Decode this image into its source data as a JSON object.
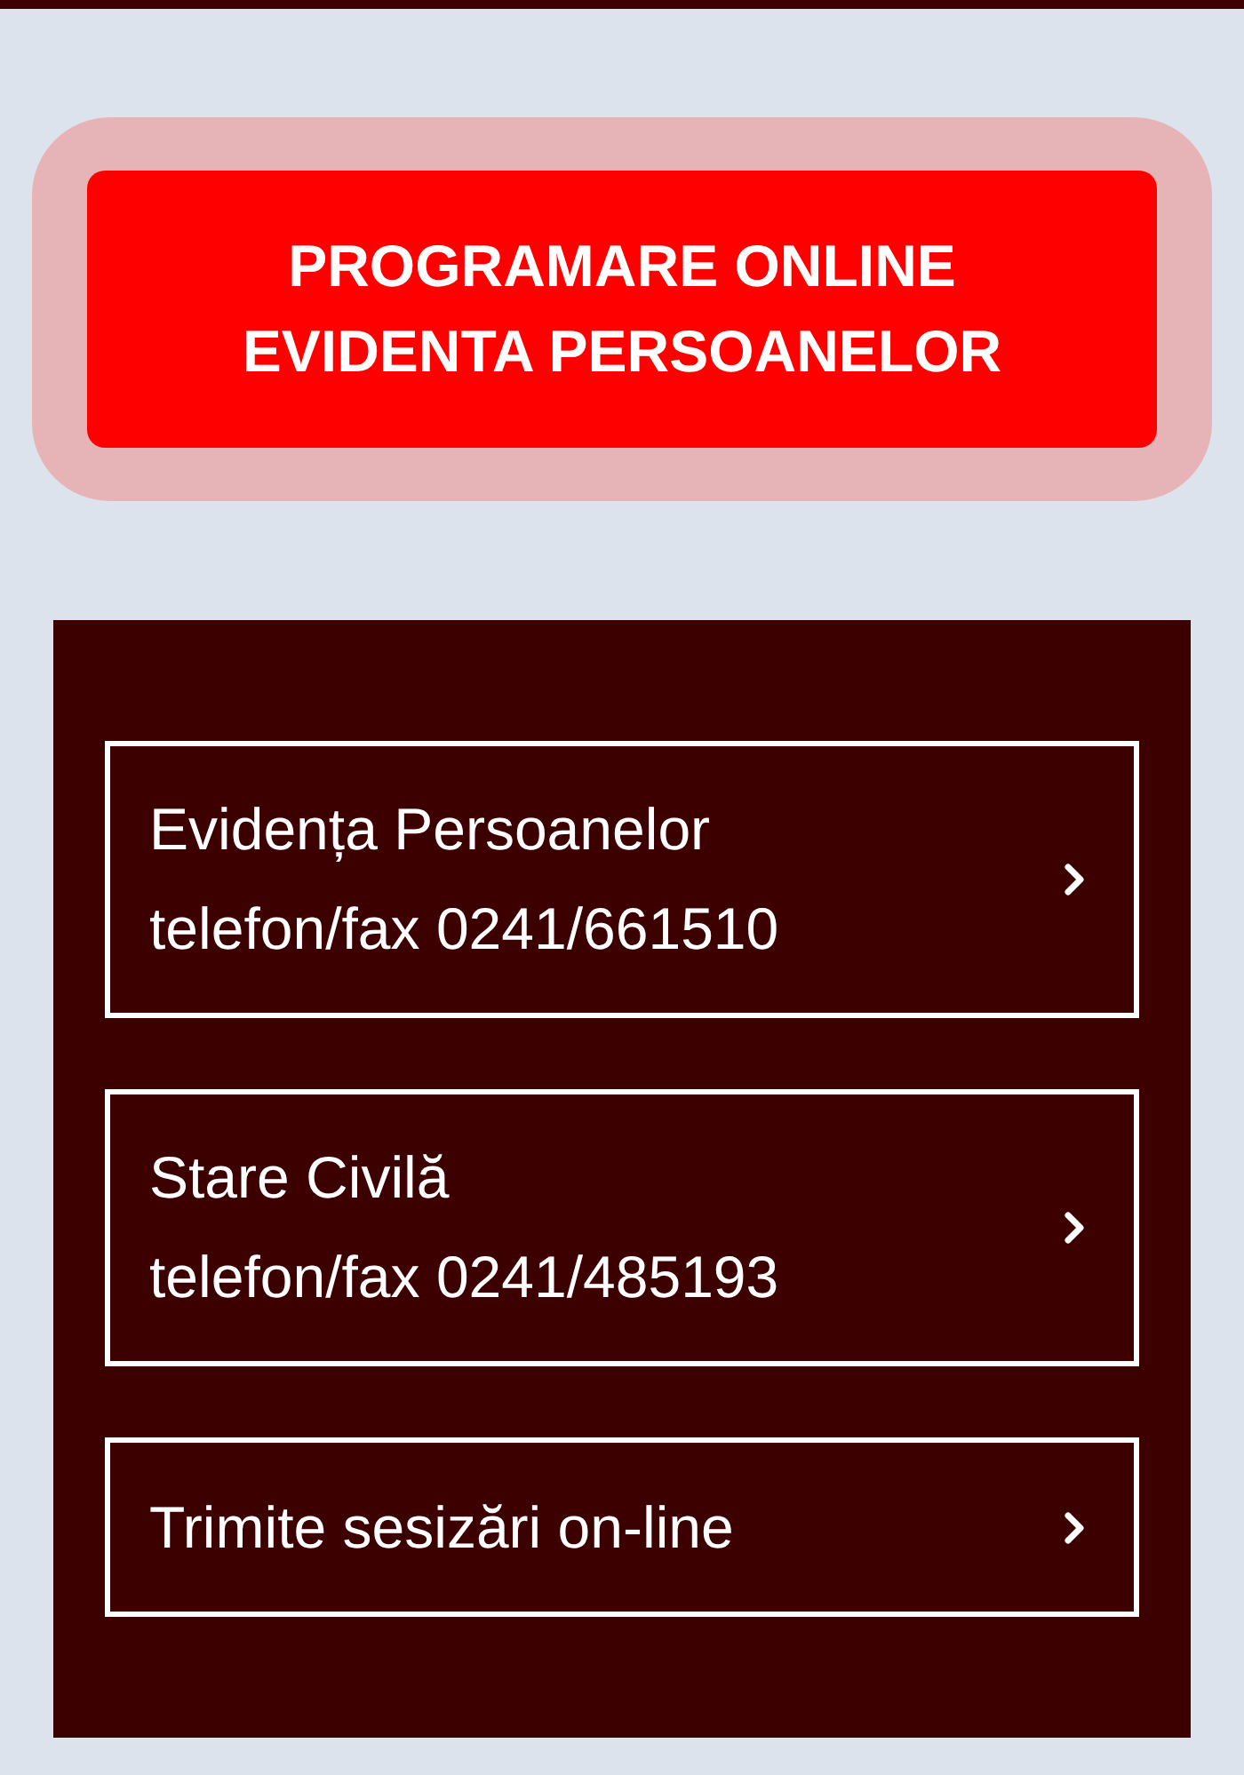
{
  "appointment_button": {
    "lines": [
      "PROGRAMARE ONLINE",
      "EVIDENTA PERSOANELOR"
    ]
  },
  "links": [
    {
      "lines": [
        "Evidența Persoanelor",
        "telefon/fax 0241/661510"
      ]
    },
    {
      "lines": [
        "Stare Civilă",
        "telefon/fax 0241/485193"
      ]
    },
    {
      "lines": [
        "Trimite sesizări on-line"
      ]
    }
  ]
}
